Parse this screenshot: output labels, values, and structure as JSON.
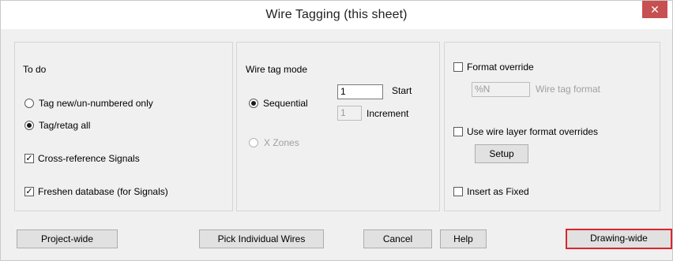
{
  "dialog": {
    "title": "Wire Tagging (this sheet)",
    "close_glyph": "✕"
  },
  "todo": {
    "heading": "To do",
    "options": [
      {
        "label": "Tag new/un-numbered only",
        "selected": false
      },
      {
        "label": "Tag/retag all",
        "selected": true
      }
    ],
    "cross_reference_label": "Cross-reference Signals",
    "cross_reference_checked": true,
    "freshen_label": "Freshen database (for Signals)",
    "freshen_checked": true
  },
  "mode": {
    "heading": "Wire tag mode",
    "sequential_label": "Sequential",
    "sequential_selected": true,
    "start_value": "1",
    "start_label": "Start",
    "increment_value": "1",
    "increment_label": "Increment",
    "xzones_label": "X Zones",
    "xzones_enabled": false
  },
  "format": {
    "override_label": "Format override",
    "override_checked": false,
    "format_value": "%N",
    "format_label": "Wire tag format",
    "layer_overrides_label": "Use wire layer format overrides",
    "layer_overrides_checked": false,
    "setup_label": "Setup",
    "insert_fixed_label": "Insert as Fixed",
    "insert_fixed_checked": false
  },
  "buttons": {
    "project_wide": "Project-wide",
    "pick_individual": "Pick Individual Wires",
    "cancel": "Cancel",
    "help": "Help",
    "drawing_wide": "Drawing-wide"
  },
  "colors": {
    "close_button": "#c75050",
    "focus_border": "#d9262b",
    "dialog_bg": "#f0f0f0"
  }
}
